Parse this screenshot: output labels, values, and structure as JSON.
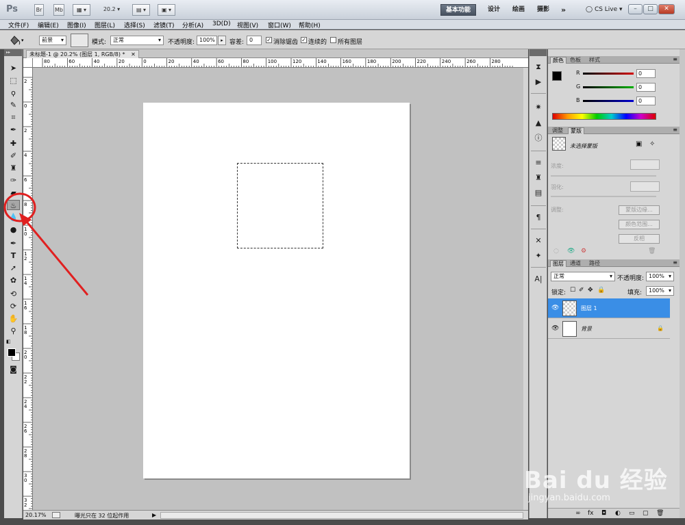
{
  "appbar": {
    "logo": "Ps",
    "br_label": "Br",
    "mb_label": "Mb",
    "zoom": "20.2",
    "workspaces": [
      "基本功能",
      "设计",
      "绘画",
      "摄影"
    ],
    "more": "»",
    "cs_live": "CS Live",
    "win_min": "–",
    "win_max": "□",
    "win_close": "✕"
  },
  "menu": [
    "文件(F)",
    "编辑(E)",
    "图像(I)",
    "图层(L)",
    "选择(S)",
    "滤镜(T)",
    "分析(A)",
    "3D(D)",
    "视图(V)",
    "窗口(W)",
    "帮助(H)"
  ],
  "options": {
    "fill_source": "前景",
    "mode_label": "模式:",
    "mode_value": "正常",
    "opacity_label": "不透明度:",
    "opacity_value": "100%",
    "tolerance_label": "容差:",
    "tolerance_value": "0",
    "antialias_label": "消除锯齿",
    "contiguous_label": "连续的",
    "all_layers_label": "所有图层",
    "check_mark": "✓"
  },
  "document": {
    "tab_title": "未标题-1 @ 20.2% (图层 1, RGB/8) *",
    "tab_close": "✕",
    "ruler_h": [
      "80",
      "60",
      "40",
      "20",
      "0",
      "20",
      "40",
      "60",
      "80",
      "100",
      "120",
      "140",
      "160",
      "180",
      "200",
      "220",
      "240",
      "260",
      "280"
    ],
    "ruler_v": [
      "2",
      "0",
      "2",
      "4",
      "6",
      "8",
      "1 0",
      "1 2",
      "1 4",
      "1 6",
      "1 8",
      "2 0",
      "2 2",
      "2 4",
      "2 6",
      "2 8",
      "3 0",
      "3 2"
    ],
    "zoom": "20.17%",
    "status": "曝光只在 32 位起作用",
    "play": "▶"
  },
  "color_panel": {
    "tabs": [
      "颜色",
      "色板",
      "样式"
    ],
    "channels": [
      {
        "label": "R",
        "value": "0",
        "color": "#d40000"
      },
      {
        "label": "G",
        "value": "0",
        "color": "#00b000"
      },
      {
        "label": "B",
        "value": "0",
        "color": "#0000d0"
      }
    ]
  },
  "mask_panel": {
    "tabs": [
      "调整",
      "蒙版"
    ],
    "title": "未选择蒙版",
    "density_label": "浓度:",
    "feather_label": "羽化:",
    "refine_label": "调整:",
    "buttons": [
      "蒙版边缘...",
      "颜色范围...",
      "反相"
    ]
  },
  "layers_panel": {
    "tabs": [
      "图层",
      "通道",
      "路径"
    ],
    "blend_mode": "正常",
    "opacity_label": "不透明度:",
    "opacity_value": "100%",
    "lock_label": "锁定:",
    "fill_label": "填充:",
    "fill_value": "100%",
    "layers": [
      {
        "name": "图层 1",
        "selected": true
      },
      {
        "name": "背景",
        "selected": false,
        "locked": true
      }
    ],
    "eye": "👁",
    "lock_icon": "🔒"
  },
  "watermark": {
    "brand": "Bai du 经验",
    "url": "jingyan.baidu.com"
  },
  "colors": {
    "selected_layer": "#3a8ee6",
    "annotation": "#e02020"
  }
}
